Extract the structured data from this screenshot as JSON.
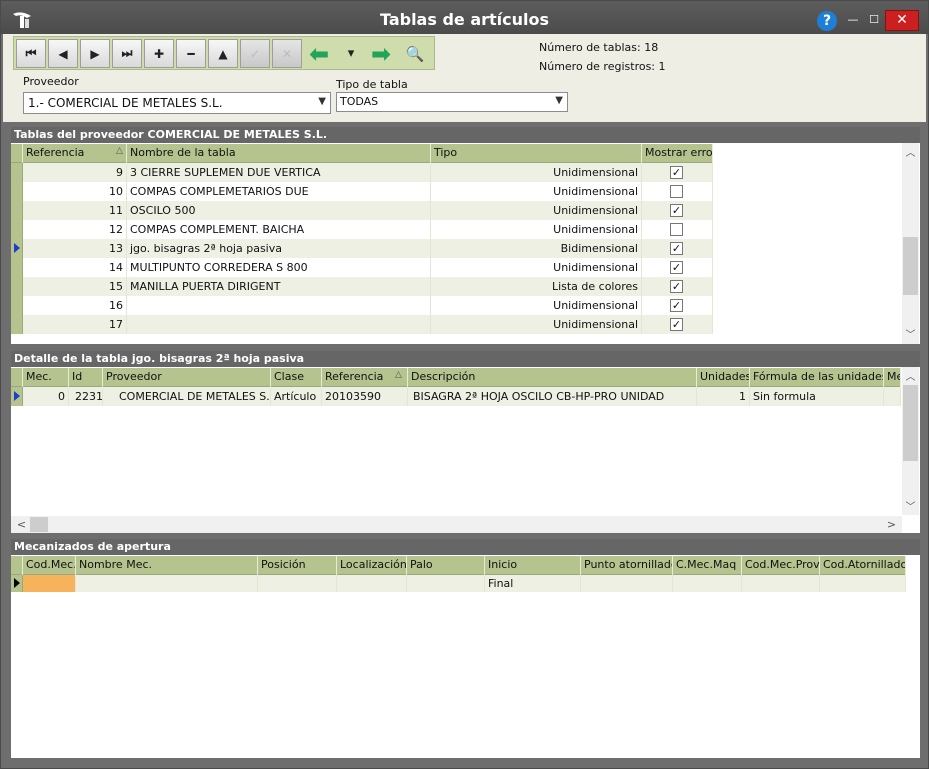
{
  "window": {
    "title": "Tablas de artículos",
    "help": "?",
    "minimize": "—",
    "maximize": "☐",
    "close": "✕"
  },
  "toolbar": {
    "first": "⏮",
    "prev": "◀",
    "next": "▶",
    "last": "⏭",
    "add": "✚",
    "remove": "━",
    "up": "▲",
    "confirm": "✓",
    "cancel": "✕",
    "back": "⬅",
    "dropdown": "▾",
    "forward": "➡",
    "search": "🔍"
  },
  "counts": {
    "tables": "Número de tablas: 18",
    "records": "Número de registros: 1"
  },
  "filters": {
    "proveedor_label": "Proveedor",
    "proveedor_value": "1.- COMERCIAL DE METALES S.L.",
    "tipo_label": "Tipo de tabla",
    "tipo_value": "TODAS"
  },
  "tables_panel": {
    "title": "Tablas del proveedor COMERCIAL DE METALES S.L.",
    "headers": {
      "ref": "Referencia",
      "name": "Nombre de la tabla",
      "tipo": "Tipo",
      "error": "Mostrar error"
    },
    "rows": [
      {
        "ref": "9",
        "name": "3 CIERRE SUPLEMEN DUE VERTICA",
        "tipo": "Unidimensional",
        "error": true,
        "current": false
      },
      {
        "ref": "10",
        "name": "COMPAS COMPLEMETARIOS DUE",
        "tipo": "Unidimensional",
        "error": false,
        "current": false
      },
      {
        "ref": "11",
        "name": "OSCILO 500",
        "tipo": "Unidimensional",
        "error": true,
        "current": false
      },
      {
        "ref": "12",
        "name": "COMPAS COMPLEMENT. BAICHA",
        "tipo": "Unidimensional",
        "error": false,
        "current": false
      },
      {
        "ref": "13",
        "name": "jgo. bisagras 2ª hoja pasiva",
        "tipo": "Bidimensional",
        "error": true,
        "current": true
      },
      {
        "ref": "14",
        "name": "MULTIPUNTO CORREDERA S 800",
        "tipo": "Unidimensional",
        "error": true,
        "current": false
      },
      {
        "ref": "15",
        "name": "MANILLA PUERTA DIRIGENT",
        "tipo": "Lista de colores",
        "error": true,
        "current": false
      },
      {
        "ref": "16",
        "name": "",
        "tipo": "Unidimensional",
        "error": true,
        "current": false
      },
      {
        "ref": "17",
        "name": "",
        "tipo": "Unidimensional",
        "error": true,
        "current": false
      }
    ]
  },
  "detail_panel": {
    "title": "Detalle de la tabla jgo. bisagras 2ª hoja pasiva",
    "headers": {
      "mec": "Mec.",
      "id": "Id",
      "prov": "Proveedor",
      "clase": "Clase",
      "ref": "Referencia",
      "desc": "Descripción",
      "unid": "Unidades",
      "formula": "Fórmula de las unidades",
      "more": "Me"
    },
    "rows": [
      {
        "mec": "0",
        "id": "2231",
        "prov": "COMERCIAL DE METALES S.L.",
        "clase": "Artículo",
        "ref": "20103590",
        "desc": "BISAGRA 2ª HOJA OSCILO CB-HP-PRO UNIDAD",
        "unid": "1",
        "formula": "Sin formula"
      }
    ]
  },
  "mec_panel": {
    "title": "Mecanizados de apertura",
    "headers": {
      "cod": "Cod.Mec.",
      "nombre": "Nombre Mec.",
      "pos": "Posición",
      "loc": "Localización",
      "palo": "Palo",
      "inicio": "Inicio",
      "punto": "Punto atornillado",
      "cmaq": "C.Mec.Maq",
      "codprov": "Cod.Mec.Prov.",
      "codat": "Cod.Atornillado"
    },
    "rows": [
      {
        "inicio": "Final"
      }
    ]
  },
  "colors": {
    "header_green": "#b5c38e",
    "row_even": "#eef0e3",
    "current_cell": "#f7b35c"
  }
}
